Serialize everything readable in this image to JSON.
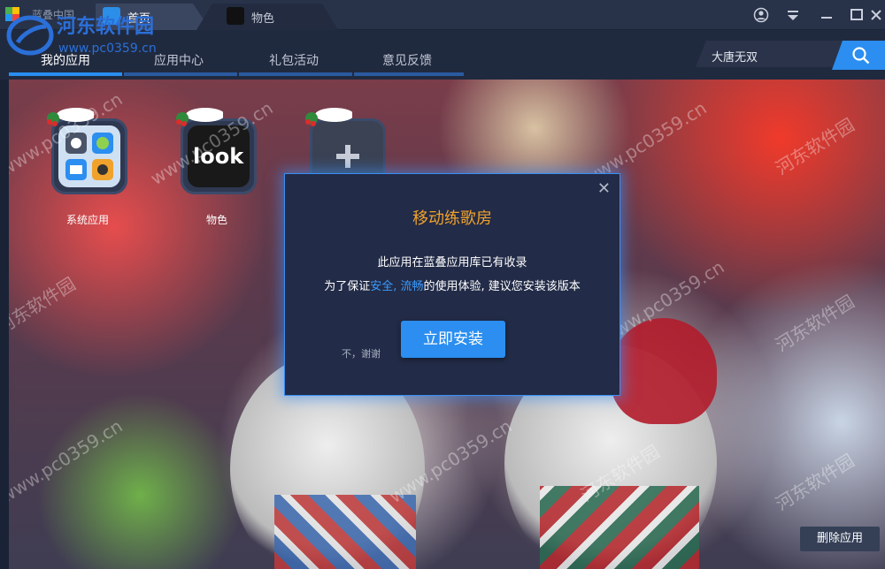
{
  "titlebar": {
    "logo_text": "蓝叠中国",
    "tabs": [
      {
        "label": "首页",
        "icon": "home-app-icon"
      },
      {
        "label": "物色",
        "icon": "look-app-icon"
      }
    ],
    "controls": [
      "user-icon",
      "dropdown-icon",
      "minimize-icon",
      "maximize-icon",
      "close-icon"
    ]
  },
  "nav": {
    "items": [
      {
        "label": "我的应用",
        "active": true
      },
      {
        "label": "应用中心",
        "active": false
      },
      {
        "label": "礼包活动",
        "active": false
      },
      {
        "label": "意见反馈",
        "active": false
      }
    ],
    "search_value": "大唐无双",
    "search_icon": "search-icon"
  },
  "apps": [
    {
      "name": "系统应用",
      "icon": "system-apps-icon"
    },
    {
      "name": "物色",
      "icon": "look-app-icon"
    },
    {
      "name": "",
      "icon": "add-app-icon"
    }
  ],
  "dialog": {
    "title": "移动练歌房",
    "line1": "此应用在蓝叠应用库已有收录",
    "line2_prefix": "为了保证",
    "line2_highlight": "安全, 流畅",
    "line2_suffix": "的使用体验, 建议您安装该版本",
    "decline": "不，谢谢",
    "install": "立即安装",
    "close_icon": "close-icon"
  },
  "delete_button": "删除应用",
  "watermark": {
    "title": "河东软件园",
    "url": "www.pc0359.cn"
  },
  "colors": {
    "accent": "#2b8ef0",
    "dialog_title": "#f0a22c",
    "highlight": "#3b9cff",
    "bar_bg": "#202a3f"
  }
}
